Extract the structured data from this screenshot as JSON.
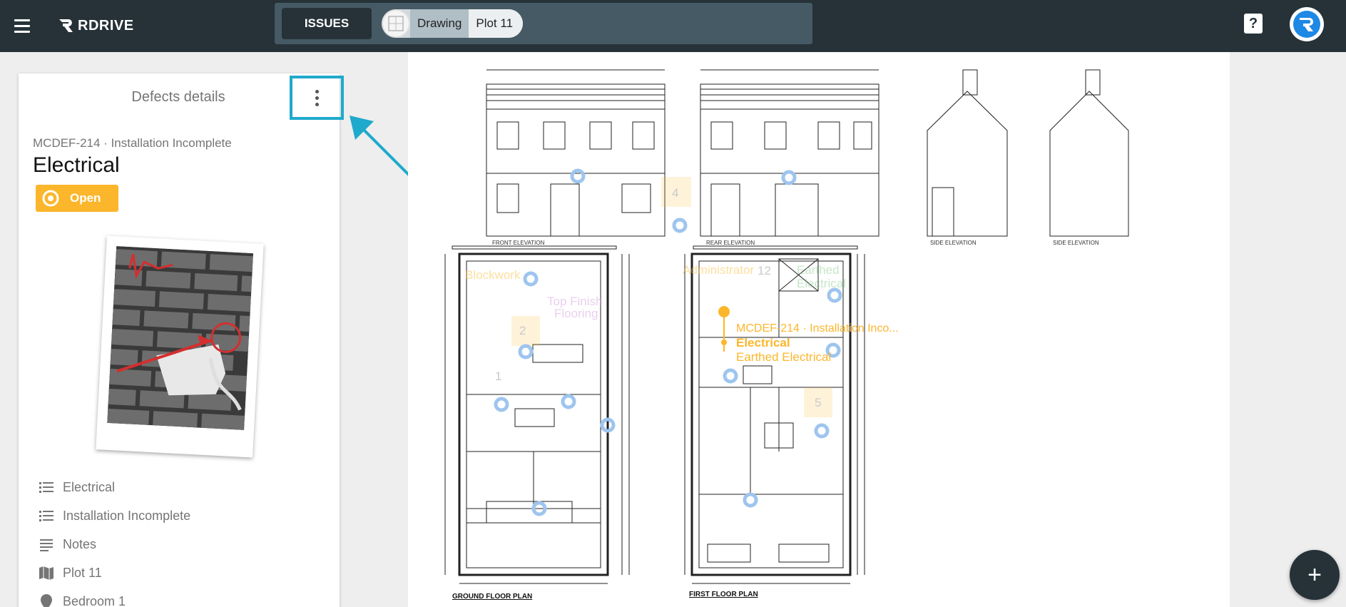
{
  "header": {
    "logo_text": "RDRIVE",
    "issues_label": "ISSUES",
    "breadcrumb_drawing": "Drawing",
    "breadcrumb_plot": "Plot 11",
    "help_icon": "help-icon",
    "avatar_icon": "user-avatar-r"
  },
  "details": {
    "title": "Defects details",
    "ref_line": "MCDEF-214 · Installation Incomplete",
    "defect_name": "Electrical",
    "status": "Open",
    "status_color": "#fbb62b",
    "items": [
      {
        "icon": "list-icon",
        "label": "Electrical"
      },
      {
        "icon": "list-icon",
        "label": "Installation Incomplete"
      },
      {
        "icon": "notes-icon",
        "label": "Notes"
      },
      {
        "icon": "map-icon",
        "label": "Plot 11"
      },
      {
        "icon": "location-pin-icon",
        "label": "Bedroom 1"
      }
    ]
  },
  "drawing": {
    "selected_pin_ref": "MCDEF-214 · Installation Inco...",
    "selected_pin_title": "Electrical",
    "selected_pin_sub": "Earthed Electrical",
    "labels": {
      "front": "FRONT ELEVATION",
      "rear": "REAR ELEVATION",
      "side1": "SIDE ELEVATION",
      "side2": "SIDE ELEVATION",
      "ground": "GROUND FLOOR PLAN",
      "first": "FIRST FLOOR PLAN",
      "top_finish": "Top Finish",
      "flooring": "Flooring",
      "blockwork": "Blockwork",
      "administrator": "Administrator",
      "earthed": "Earthed",
      "electrical": "Electrical",
      "n4": "4",
      "n2": "2",
      "n1": "1",
      "n5": "5",
      "n12": "12"
    },
    "accent": "#fbb62b",
    "pin_color": "#9ec5ee"
  },
  "fab_label": "+"
}
